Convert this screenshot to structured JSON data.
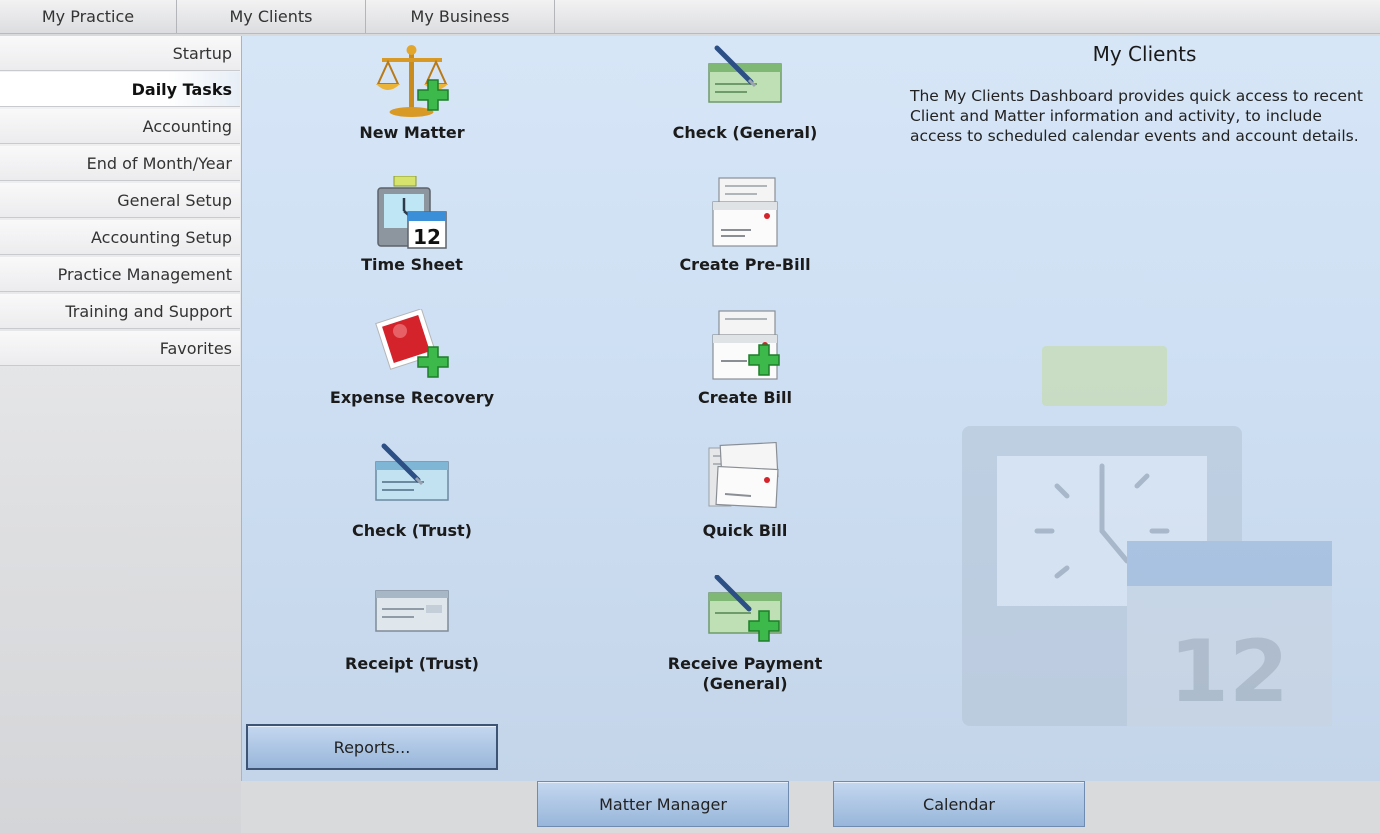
{
  "top_tabs": [
    "My Practice",
    "My Clients",
    "My Business"
  ],
  "sidebar": {
    "items": [
      {
        "label": "Startup"
      },
      {
        "label": "Daily Tasks",
        "active": true
      },
      {
        "label": "Accounting"
      },
      {
        "label": "End of Month/Year"
      },
      {
        "label": "General Setup"
      },
      {
        "label": "Accounting Setup"
      },
      {
        "label": "Practice Management"
      },
      {
        "label": "Training and Support"
      },
      {
        "label": "Favorites"
      }
    ]
  },
  "tasks": {
    "new_matter": {
      "label": "New Matter",
      "icon": "scales-plus-icon"
    },
    "check_general": {
      "label": "Check (General)",
      "icon": "check-pen-icon"
    },
    "time_sheet": {
      "label": "Time Sheet",
      "icon": "clock-calendar-icon"
    },
    "create_pre_bill": {
      "label": "Create Pre-Bill",
      "icon": "bill-envelope-icon"
    },
    "expense_recovery": {
      "label": "Expense Recovery",
      "icon": "stamp-plus-icon"
    },
    "create_bill": {
      "label": "Create Bill",
      "icon": "bill-plus-icon"
    },
    "check_trust": {
      "label": "Check (Trust)",
      "icon": "check-pen-blue-icon"
    },
    "quick_bill": {
      "label": "Quick Bill",
      "icon": "quick-bill-icon"
    },
    "receipt_trust": {
      "label": "Receipt (Trust)",
      "icon": "receipt-icon"
    },
    "receive_payment": {
      "label_line1": "Receive Payment",
      "label_line2": "(General)",
      "icon": "payment-plus-icon"
    }
  },
  "calendar_day": "12",
  "info": {
    "title": "My Clients",
    "description": "The My Clients Dashboard provides quick access to recent Client and Matter information and activity, to include access to scheduled calendar events and account details."
  },
  "buttons": {
    "reports": "Reports...",
    "matter_manager": "Matter Manager",
    "calendar": "Calendar"
  },
  "colors": {
    "panel": "#cfe0f4",
    "button": "#a9c3e3",
    "plus_green": "#3cb94a",
    "stamp_red": "#d4232b"
  }
}
